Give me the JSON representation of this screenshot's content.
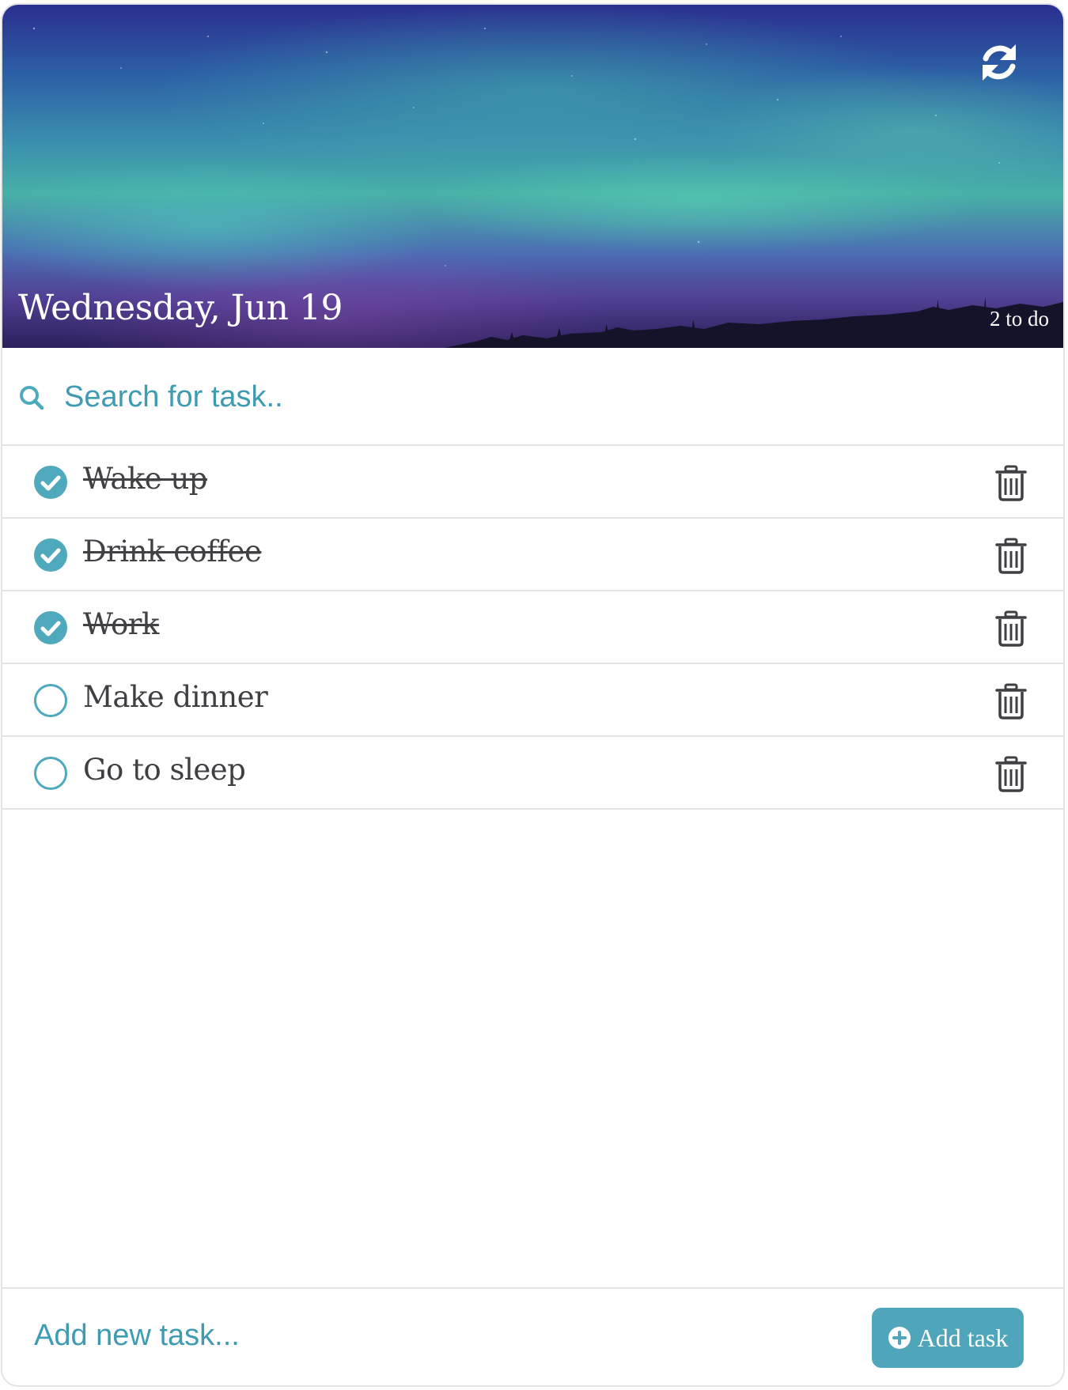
{
  "header": {
    "date": "Wednesday, Jun 19",
    "count_label": "2 to do",
    "refresh_icon": "refresh-icon"
  },
  "search": {
    "placeholder": "Search for task..",
    "icon": "search-icon"
  },
  "tasks": [
    {
      "label": "Wake up",
      "done": true
    },
    {
      "label": "Drink coffee",
      "done": true
    },
    {
      "label": "Work",
      "done": true
    },
    {
      "label": "Make dinner",
      "done": false
    },
    {
      "label": "Go to sleep",
      "done": false
    }
  ],
  "footer": {
    "new_task_placeholder": "Add new task...",
    "add_button_label": "Add task",
    "add_button_icon": "plus-circle-icon"
  },
  "colors": {
    "accent": "#4fa9bd",
    "text": "#3d3f42",
    "divider": "#e2e2e2"
  }
}
